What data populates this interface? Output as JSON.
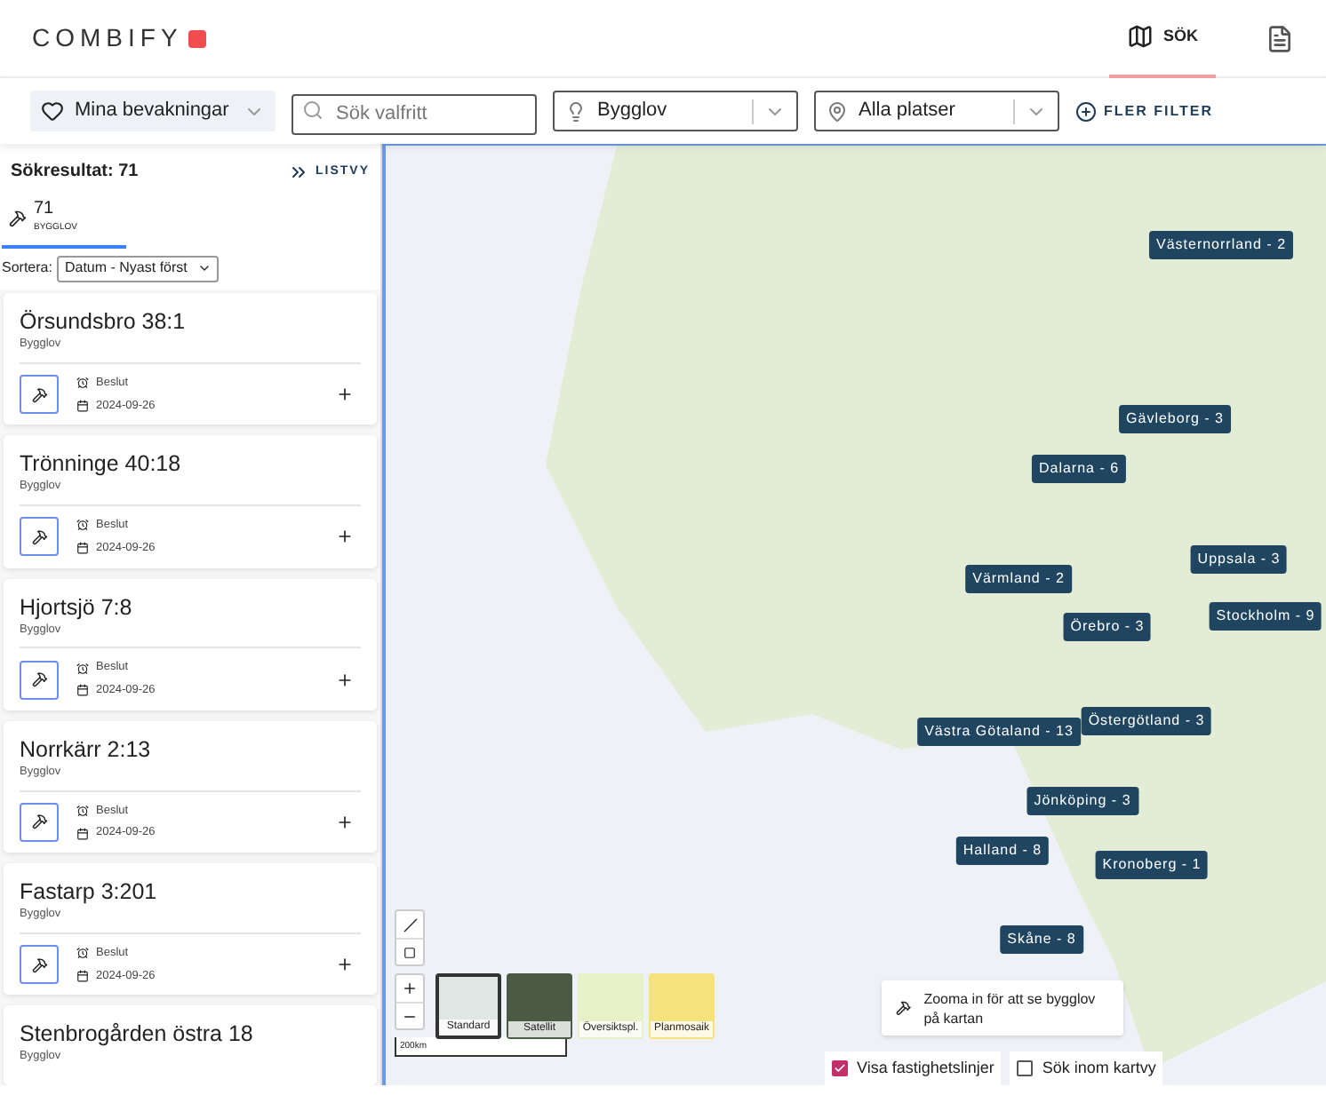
{
  "header": {
    "logo": "COMBIFY",
    "nav": [
      {
        "label": "SÖK",
        "selected": true
      }
    ]
  },
  "filters": {
    "watchlist": "Mina bevakningar",
    "search": {
      "placeholder": "Sök valfritt"
    },
    "type": "Bygglov",
    "location": "Alla platser",
    "more": "FLER FILTER"
  },
  "results": {
    "title": "Sökresultat: 71",
    "view_toggle": "LISTVY",
    "tabs": [
      {
        "count": "71",
        "label": "BYGGLOV",
        "selected": true
      }
    ],
    "sort_label": "Sortera:",
    "sort_value": "Datum - Nyast först"
  },
  "cards": [
    {
      "title": "Örsundsbro 38:1",
      "type": "Bygglov",
      "status": "Beslut",
      "date": "2024-09-26"
    },
    {
      "title": "Trönninge 40:18",
      "type": "Bygglov",
      "status": "Beslut",
      "date": "2024-09-26"
    },
    {
      "title": "Hjortsjö 7:8",
      "type": "Bygglov",
      "status": "Beslut",
      "date": "2024-09-26"
    },
    {
      "title": "Norrkärr 2:13",
      "type": "Bygglov",
      "status": "Beslut",
      "date": "2024-09-26"
    },
    {
      "title": "Fastarp 3:201",
      "type": "Bygglov",
      "status": "Beslut",
      "date": "2024-09-26"
    },
    {
      "title": "Stenbrogården östra 18",
      "type": "Bygglov"
    }
  ],
  "map": {
    "markers": [
      {
        "label": "Västernorrland - 2"
      },
      {
        "label": "Gävleborg - 3"
      },
      {
        "label": "Dalarna - 6"
      },
      {
        "label": "Värmland - 2"
      },
      {
        "label": "Uppsala - 3"
      },
      {
        "label": "Örebro - 3"
      },
      {
        "label": "Stockholm - 9"
      },
      {
        "label": "Västra Götaland - 13"
      },
      {
        "label": "Östergötland - 3"
      },
      {
        "label": "Jönköping - 3"
      },
      {
        "label": "Halland - 8"
      },
      {
        "label": "Kronoberg - 1"
      },
      {
        "label": "Skåne - 8"
      }
    ],
    "layers": [
      {
        "label": "Standard",
        "selected": true
      },
      {
        "label": "Satellit",
        "selected": false
      },
      {
        "label": "Översiktspl.",
        "selected": false
      },
      {
        "label": "Planmosaik",
        "selected": false
      }
    ],
    "scale": "200km",
    "hint": "Zooma in för att se bygglov på kartan",
    "checkboxes": [
      {
        "label": "Visa fastighetslinjer",
        "checked": true
      },
      {
        "label": "Sök inom kartvy",
        "checked": false
      }
    ]
  }
}
